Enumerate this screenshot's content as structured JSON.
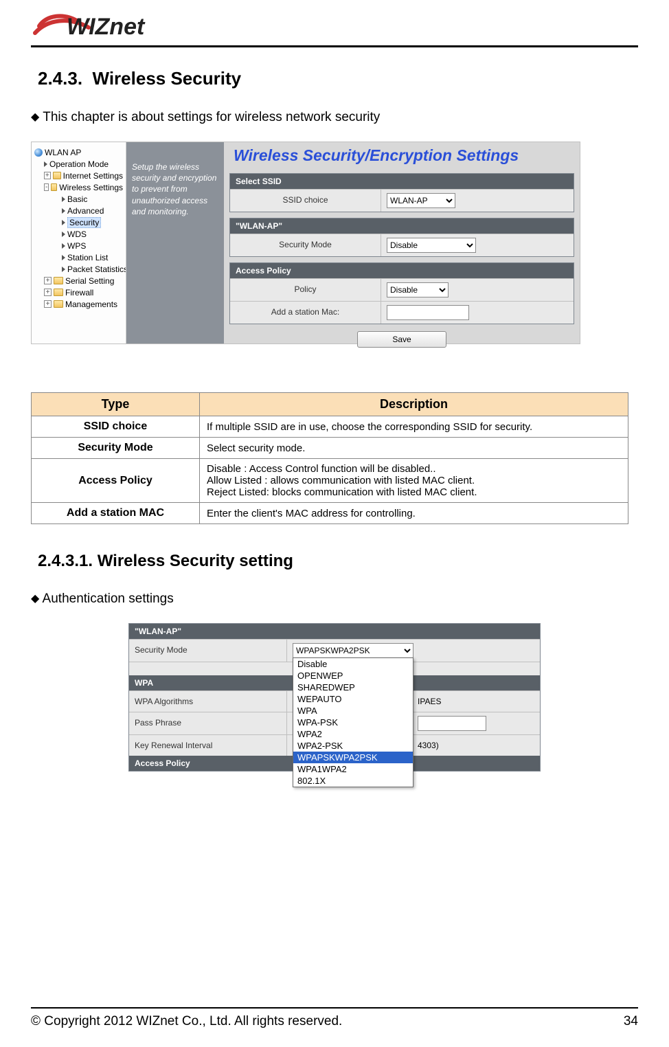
{
  "logo_text": "WIZnet",
  "section_number": "2.4.3.",
  "section_title": "Wireless  Security",
  "intro_bullet": "This chapter is about settings for wireless network security",
  "shot1": {
    "tree_root": "WLAN AP",
    "tree": {
      "operation_mode": "Operation Mode",
      "internet_settings": "Internet Settings",
      "wireless_settings": "Wireless Settings",
      "basic": "Basic",
      "advanced": "Advanced",
      "security": "Security",
      "wds": "WDS",
      "wps": "WPS",
      "station_list": "Station List",
      "packet_statistics": "Packet Statistics",
      "serial_setting": "Serial Setting",
      "firewall": "Firewall",
      "managements": "Managements"
    },
    "hint": "Setup the wireless security and encryption to prevent from unauthorized access and monitoring.",
    "panel_title": "Wireless Security/Encryption Settings",
    "group_ssid": "Select SSID",
    "ssid_choice_label": "SSID choice",
    "ssid_choice_value": "WLAN-AP",
    "group_wlan": "\"WLAN-AP\"",
    "security_mode_label": "Security Mode",
    "security_mode_value": "Disable",
    "group_policy": "Access Policy",
    "policy_label": "Policy",
    "policy_value": "Disable",
    "add_mac_label": "Add a station Mac:",
    "add_mac_value": "",
    "save_button": "Save"
  },
  "desc_table": {
    "head_type": "Type",
    "head_desc": "Description",
    "rows": [
      {
        "type": "SSID choice",
        "desc": "If multiple SSID are in use, choose the corresponding SSID for security."
      },
      {
        "type": "Security Mode",
        "desc": "Select security mode."
      },
      {
        "type": "Access Policy",
        "desc": "Disable : Access Control function will be disabled..\nAllow Listed : allows communication with listed MAC client.\nReject Listed: blocks communication with listed MAC client."
      },
      {
        "type": "Add a station MAC",
        "desc": "Enter the client's MAC address for controlling."
      }
    ]
  },
  "subsection_number": "2.4.3.1.",
  "subsection_title": "Wireless  Security  setting",
  "auth_bullet": "Authentication settings",
  "shot2": {
    "group_wlan": "\"WLAN-AP\"",
    "security_mode_label": "Security Mode",
    "security_mode_value": "WPAPSKWPA2PSK",
    "group_wpa": "WPA",
    "wpa_alg_label": "WPA Algorithms",
    "wpa_alg_trailing": "IPAES",
    "passphrase_label": "Pass Phrase",
    "key_renewal_label": "Key Renewal Interval",
    "key_renewal_trailing": "4303)",
    "group_policy": "Access Policy",
    "dropdown_options": [
      "Disable",
      "OPENWEP",
      "SHAREDWEP",
      "WEPAUTO",
      "WPA",
      "WPA-PSK",
      "WPA2",
      "WPA2-PSK",
      "WPAPSKWPA2PSK",
      "WPA1WPA2",
      "802.1X"
    ],
    "dropdown_selected_index": 8
  },
  "footer": {
    "copyright": "© Copyright 2012 WIZnet Co., Ltd. All rights reserved.",
    "page_number": "34"
  }
}
